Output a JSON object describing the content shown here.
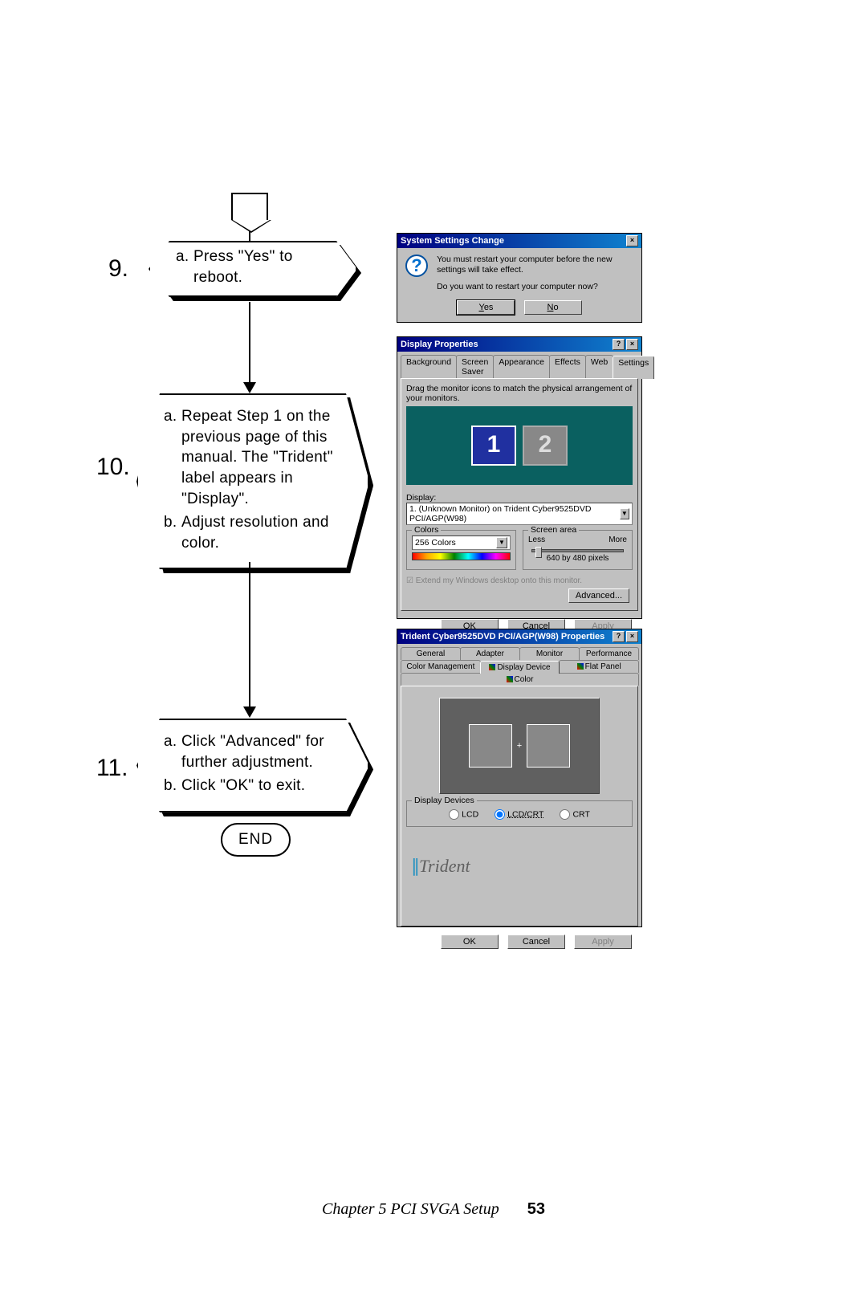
{
  "flowchart": {
    "step9": {
      "num": "9.",
      "a": "Press \"Yes\" to reboot."
    },
    "step10": {
      "num": "10.",
      "a": "Repeat Step 1 on the previous page of this manual. The \"Trident\" label appears in \"Display\".",
      "b": "Adjust resolution and color."
    },
    "step11": {
      "num": "11.",
      "a": "Click \"Advanced\" for further adjustment.",
      "b": "Click \"OK\" to exit."
    },
    "end": "END"
  },
  "dialog1": {
    "title": "System Settings Change",
    "msg1": "You must restart your computer before the new settings will take effect.",
    "msg2": "Do you want to restart your computer now?",
    "yes": "Yes",
    "no": "No"
  },
  "dialog2": {
    "title": "Display Properties",
    "tabs": [
      "Background",
      "Screen Saver",
      "Appearance",
      "Effects",
      "Web",
      "Settings"
    ],
    "active_tab": "Settings",
    "hint": "Drag the monitor icons to match the physical arrangement of your monitors.",
    "mon1": "1",
    "mon2": "2",
    "display_label": "Display:",
    "display_value": "1. (Unknown Monitor) on Trident Cyber9525DVD PCI/AGP(W98)",
    "colors_label": "Colors",
    "colors_value": "256 Colors",
    "screen_label": "Screen area",
    "less": "Less",
    "more": "More",
    "res": "640 by 480 pixels",
    "extend": "Extend my Windows desktop onto this monitor.",
    "advanced": "Advanced...",
    "ok": "OK",
    "cancel": "Cancel",
    "apply": "Apply"
  },
  "dialog3": {
    "title": "Trident Cyber9525DVD PCI/AGP(W98) Properties",
    "tabs_row1": [
      "General",
      "Adapter",
      "Monitor",
      "Performance"
    ],
    "tabs_row2": [
      "Color Management",
      "Display Device",
      "Flat Panel",
      "Color"
    ],
    "active_tab": "Display Device",
    "group": "Display Devices",
    "options": {
      "lcd": "LCD",
      "lcdcrt": "LCD/CRT",
      "crt": "CRT"
    },
    "selected": "lcdcrt",
    "brand": "Trident",
    "ok": "OK",
    "cancel": "Cancel",
    "apply": "Apply"
  },
  "footer": {
    "chapter": "Chapter 5   PCI SVGA Setup",
    "page": "53"
  }
}
